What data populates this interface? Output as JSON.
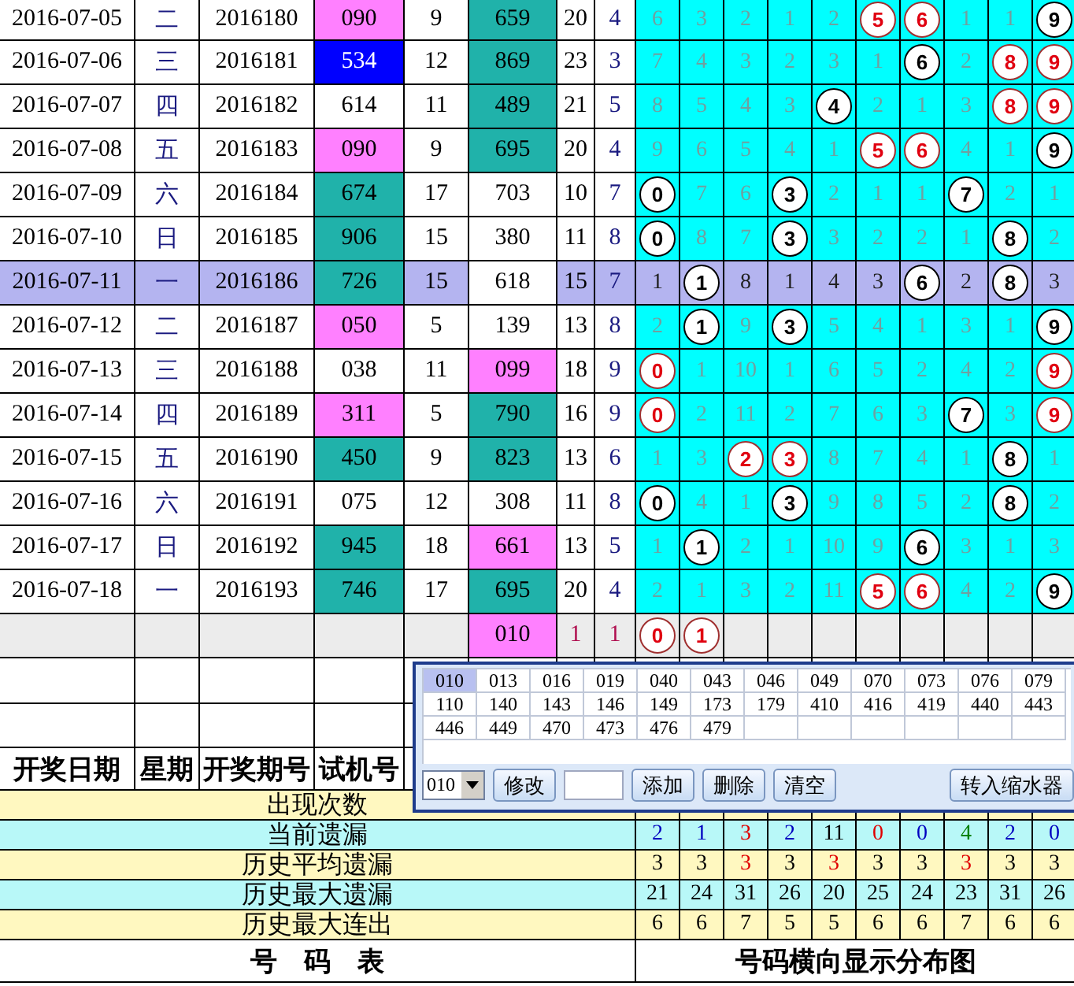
{
  "draws": [
    {
      "date": "2016-07-05",
      "weekday": "二",
      "issue": "2016180",
      "trial": {
        "text": "090",
        "color": "#ff80ff"
      },
      "column_5": "9",
      "column_6": {
        "text": "659",
        "color": "#20b2aa"
      },
      "column_7": "20",
      "column_8": "4",
      "selected": false,
      "grid": [
        {
          "text": "6",
          "kind": "miss"
        },
        {
          "text": "3",
          "kind": "miss"
        },
        {
          "text": "2",
          "kind": "miss"
        },
        {
          "text": "1",
          "kind": "miss"
        },
        {
          "text": "2",
          "kind": "miss"
        },
        {
          "text": "5",
          "kind": "repeat"
        },
        {
          "text": "6",
          "kind": "repeat"
        },
        {
          "text": "1",
          "kind": "miss"
        },
        {
          "text": "1",
          "kind": "miss"
        },
        {
          "text": "9",
          "kind": "hit"
        }
      ]
    },
    {
      "date": "2016-07-06",
      "weekday": "三",
      "issue": "2016181",
      "trial": {
        "text": "534",
        "color": "#0000ff"
      },
      "column_5": "12",
      "column_6": {
        "text": "869",
        "color": "#20b2aa"
      },
      "column_7": "23",
      "column_8": "3",
      "selected": false,
      "grid": [
        {
          "text": "7",
          "kind": "miss"
        },
        {
          "text": "4",
          "kind": "miss"
        },
        {
          "text": "3",
          "kind": "miss"
        },
        {
          "text": "2",
          "kind": "miss"
        },
        {
          "text": "3",
          "kind": "miss"
        },
        {
          "text": "1",
          "kind": "miss"
        },
        {
          "text": "6",
          "kind": "hit"
        },
        {
          "text": "2",
          "kind": "miss"
        },
        {
          "text": "8",
          "kind": "repeat"
        },
        {
          "text": "9",
          "kind": "repeat"
        }
      ]
    },
    {
      "date": "2016-07-07",
      "weekday": "四",
      "issue": "2016182",
      "trial": {
        "text": "614",
        "color": "#ffffff"
      },
      "column_5": "11",
      "column_6": {
        "text": "489",
        "color": "#20b2aa"
      },
      "column_7": "21",
      "column_8": "5",
      "selected": false,
      "grid": [
        {
          "text": "8",
          "kind": "miss"
        },
        {
          "text": "5",
          "kind": "miss"
        },
        {
          "text": "4",
          "kind": "miss"
        },
        {
          "text": "3",
          "kind": "miss"
        },
        {
          "text": "4",
          "kind": "hit"
        },
        {
          "text": "2",
          "kind": "miss"
        },
        {
          "text": "1",
          "kind": "miss"
        },
        {
          "text": "3",
          "kind": "miss"
        },
        {
          "text": "8",
          "kind": "repeat"
        },
        {
          "text": "9",
          "kind": "repeat"
        }
      ]
    },
    {
      "date": "2016-07-08",
      "weekday": "五",
      "issue": "2016183",
      "trial": {
        "text": "090",
        "color": "#ff80ff"
      },
      "column_5": "9",
      "column_6": {
        "text": "695",
        "color": "#20b2aa"
      },
      "column_7": "20",
      "column_8": "4",
      "selected": false,
      "grid": [
        {
          "text": "9",
          "kind": "miss"
        },
        {
          "text": "6",
          "kind": "miss"
        },
        {
          "text": "5",
          "kind": "miss"
        },
        {
          "text": "4",
          "kind": "miss"
        },
        {
          "text": "1",
          "kind": "miss"
        },
        {
          "text": "5",
          "kind": "repeat"
        },
        {
          "text": "6",
          "kind": "repeat"
        },
        {
          "text": "4",
          "kind": "miss"
        },
        {
          "text": "1",
          "kind": "miss"
        },
        {
          "text": "9",
          "kind": "hit"
        }
      ]
    },
    {
      "date": "2016-07-09",
      "weekday": "六",
      "issue": "2016184",
      "trial": {
        "text": "674",
        "color": "#20b2aa"
      },
      "column_5": "17",
      "column_6": {
        "text": "703",
        "color": "#ffffff"
      },
      "column_7": "10",
      "column_8": "7",
      "selected": false,
      "grid": [
        {
          "text": "0",
          "kind": "hit"
        },
        {
          "text": "7",
          "kind": "miss"
        },
        {
          "text": "6",
          "kind": "miss"
        },
        {
          "text": "3",
          "kind": "hit"
        },
        {
          "text": "2",
          "kind": "miss"
        },
        {
          "text": "1",
          "kind": "miss"
        },
        {
          "text": "1",
          "kind": "miss"
        },
        {
          "text": "7",
          "kind": "hit"
        },
        {
          "text": "2",
          "kind": "miss"
        },
        {
          "text": "1",
          "kind": "miss"
        }
      ]
    },
    {
      "date": "2016-07-10",
      "weekday": "日",
      "issue": "2016185",
      "trial": {
        "text": "906",
        "color": "#20b2aa"
      },
      "column_5": "15",
      "column_6": {
        "text": "380",
        "color": "#ffffff"
      },
      "column_7": "11",
      "column_8": "8",
      "selected": false,
      "grid": [
        {
          "text": "0",
          "kind": "hit"
        },
        {
          "text": "8",
          "kind": "miss"
        },
        {
          "text": "7",
          "kind": "miss"
        },
        {
          "text": "3",
          "kind": "hit"
        },
        {
          "text": "3",
          "kind": "miss"
        },
        {
          "text": "2",
          "kind": "miss"
        },
        {
          "text": "2",
          "kind": "miss"
        },
        {
          "text": "1",
          "kind": "miss"
        },
        {
          "text": "8",
          "kind": "hit"
        },
        {
          "text": "2",
          "kind": "miss"
        }
      ]
    },
    {
      "date": "2016-07-11",
      "weekday": "一",
      "issue": "2016186",
      "trial": {
        "text": "726",
        "color": "#20b2aa"
      },
      "column_5": "15",
      "column_6": {
        "text": "618",
        "color": "#ffffff"
      },
      "column_7": "15",
      "column_8": "7",
      "selected": true,
      "grid": [
        {
          "text": "1",
          "kind": "miss"
        },
        {
          "text": "1",
          "kind": "hit"
        },
        {
          "text": "8",
          "kind": "miss"
        },
        {
          "text": "1",
          "kind": "miss"
        },
        {
          "text": "4",
          "kind": "miss"
        },
        {
          "text": "3",
          "kind": "miss"
        },
        {
          "text": "6",
          "kind": "hit"
        },
        {
          "text": "2",
          "kind": "miss"
        },
        {
          "text": "8",
          "kind": "hit"
        },
        {
          "text": "3",
          "kind": "miss"
        }
      ]
    },
    {
      "date": "2016-07-12",
      "weekday": "二",
      "issue": "2016187",
      "trial": {
        "text": "050",
        "color": "#ff80ff"
      },
      "column_5": "5",
      "column_6": {
        "text": "139",
        "color": "#ffffff"
      },
      "column_7": "13",
      "column_8": "8",
      "selected": false,
      "grid": [
        {
          "text": "2",
          "kind": "miss"
        },
        {
          "text": "1",
          "kind": "hit"
        },
        {
          "text": "9",
          "kind": "miss"
        },
        {
          "text": "3",
          "kind": "hit"
        },
        {
          "text": "5",
          "kind": "miss"
        },
        {
          "text": "4",
          "kind": "miss"
        },
        {
          "text": "1",
          "kind": "miss"
        },
        {
          "text": "3",
          "kind": "miss"
        },
        {
          "text": "1",
          "kind": "miss"
        },
        {
          "text": "9",
          "kind": "hit"
        }
      ]
    },
    {
      "date": "2016-07-13",
      "weekday": "三",
      "issue": "2016188",
      "trial": {
        "text": "038",
        "color": "#ffffff"
      },
      "column_5": "11",
      "column_6": {
        "text": "099",
        "color": "#ff80ff"
      },
      "column_7": "18",
      "column_8": "9",
      "selected": false,
      "grid": [
        {
          "text": "0",
          "kind": "repeat"
        },
        {
          "text": "1",
          "kind": "miss"
        },
        {
          "text": "10",
          "kind": "miss"
        },
        {
          "text": "1",
          "kind": "miss"
        },
        {
          "text": "6",
          "kind": "miss"
        },
        {
          "text": "5",
          "kind": "miss"
        },
        {
          "text": "2",
          "kind": "miss"
        },
        {
          "text": "4",
          "kind": "miss"
        },
        {
          "text": "2",
          "kind": "miss"
        },
        {
          "text": "9",
          "kind": "repeat"
        }
      ]
    },
    {
      "date": "2016-07-14",
      "weekday": "四",
      "issue": "2016189",
      "trial": {
        "text": "311",
        "color": "#ff80ff"
      },
      "column_5": "5",
      "column_6": {
        "text": "790",
        "color": "#20b2aa"
      },
      "column_7": "16",
      "column_8": "9",
      "selected": false,
      "grid": [
        {
          "text": "0",
          "kind": "repeat"
        },
        {
          "text": "2",
          "kind": "miss"
        },
        {
          "text": "11",
          "kind": "miss"
        },
        {
          "text": "2",
          "kind": "miss"
        },
        {
          "text": "7",
          "kind": "miss"
        },
        {
          "text": "6",
          "kind": "miss"
        },
        {
          "text": "3",
          "kind": "miss"
        },
        {
          "text": "7",
          "kind": "hit"
        },
        {
          "text": "3",
          "kind": "miss"
        },
        {
          "text": "9",
          "kind": "repeat"
        }
      ]
    },
    {
      "date": "2016-07-15",
      "weekday": "五",
      "issue": "2016190",
      "trial": {
        "text": "450",
        "color": "#20b2aa"
      },
      "column_5": "9",
      "column_6": {
        "text": "823",
        "color": "#20b2aa"
      },
      "column_7": "13",
      "column_8": "6",
      "selected": false,
      "grid": [
        {
          "text": "1",
          "kind": "miss"
        },
        {
          "text": "3",
          "kind": "miss"
        },
        {
          "text": "2",
          "kind": "repeat"
        },
        {
          "text": "3",
          "kind": "repeat"
        },
        {
          "text": "8",
          "kind": "miss"
        },
        {
          "text": "7",
          "kind": "miss"
        },
        {
          "text": "4",
          "kind": "miss"
        },
        {
          "text": "1",
          "kind": "miss"
        },
        {
          "text": "8",
          "kind": "hit"
        },
        {
          "text": "1",
          "kind": "miss"
        }
      ]
    },
    {
      "date": "2016-07-16",
      "weekday": "六",
      "issue": "2016191",
      "trial": {
        "text": "075",
        "color": "#ffffff"
      },
      "column_5": "12",
      "column_6": {
        "text": "308",
        "color": "#ffffff"
      },
      "column_7": "11",
      "column_8": "8",
      "selected": false,
      "grid": [
        {
          "text": "0",
          "kind": "hit"
        },
        {
          "text": "4",
          "kind": "miss"
        },
        {
          "text": "1",
          "kind": "miss"
        },
        {
          "text": "3",
          "kind": "hit"
        },
        {
          "text": "9",
          "kind": "miss"
        },
        {
          "text": "8",
          "kind": "miss"
        },
        {
          "text": "5",
          "kind": "miss"
        },
        {
          "text": "2",
          "kind": "miss"
        },
        {
          "text": "8",
          "kind": "hit"
        },
        {
          "text": "2",
          "kind": "miss"
        }
      ]
    },
    {
      "date": "2016-07-17",
      "weekday": "日",
      "issue": "2016192",
      "trial": {
        "text": "945",
        "color": "#20b2aa"
      },
      "column_5": "18",
      "column_6": {
        "text": "661",
        "color": "#ff80ff"
      },
      "column_7": "13",
      "column_8": "5",
      "selected": false,
      "grid": [
        {
          "text": "1",
          "kind": "miss"
        },
        {
          "text": "1",
          "kind": "hit"
        },
        {
          "text": "2",
          "kind": "miss"
        },
        {
          "text": "1",
          "kind": "miss"
        },
        {
          "text": "10",
          "kind": "miss"
        },
        {
          "text": "9",
          "kind": "miss"
        },
        {
          "text": "6",
          "kind": "hit"
        },
        {
          "text": "3",
          "kind": "miss"
        },
        {
          "text": "1",
          "kind": "miss"
        },
        {
          "text": "3",
          "kind": "miss"
        }
      ]
    },
    {
      "date": "2016-07-18",
      "weekday": "一",
      "issue": "2016193",
      "trial": {
        "text": "746",
        "color": "#20b2aa"
      },
      "column_5": "17",
      "column_6": {
        "text": "695",
        "color": "#20b2aa"
      },
      "column_7": "20",
      "column_8": "4",
      "selected": false,
      "grid": [
        {
          "text": "2",
          "kind": "miss"
        },
        {
          "text": "1",
          "kind": "miss"
        },
        {
          "text": "3",
          "kind": "miss"
        },
        {
          "text": "2",
          "kind": "miss"
        },
        {
          "text": "11",
          "kind": "miss"
        },
        {
          "text": "5",
          "kind": "repeat"
        },
        {
          "text": "6",
          "kind": "repeat"
        },
        {
          "text": "4",
          "kind": "miss"
        },
        {
          "text": "2",
          "kind": "miss"
        },
        {
          "text": "9",
          "kind": "hit"
        }
      ]
    }
  ],
  "pending_row": {
    "column_6": {
      "text": "010",
      "color": "#ff80ff"
    },
    "column_7": "1",
    "column_8": "1",
    "grid": [
      {
        "text": "0",
        "kind": "repeat"
      },
      {
        "text": "1",
        "kind": "repeat"
      }
    ]
  },
  "headers": [
    "开奖日期",
    "星期",
    "开奖期号",
    "试机号"
  ],
  "stats": [
    {
      "label": "出现次数"
    },
    {
      "label": "当前遗漏",
      "values": [
        {
          "text": "2",
          "color": "#0000c0"
        },
        {
          "text": "1",
          "color": "#0000c0"
        },
        {
          "text": "3",
          "color": "#e00000"
        },
        {
          "text": "2",
          "color": "#0000c0"
        },
        {
          "text": "11",
          "color": "#000000"
        },
        {
          "text": "0",
          "color": "#e00000"
        },
        {
          "text": "0",
          "color": "#0000c0"
        },
        {
          "text": "4",
          "color": "#008000"
        },
        {
          "text": "2",
          "color": "#0000c0"
        },
        {
          "text": "0",
          "color": "#0000c0"
        }
      ]
    },
    {
      "label": "历史平均遗漏",
      "values": [
        {
          "text": "3",
          "color": "#000000"
        },
        {
          "text": "3",
          "color": "#000000"
        },
        {
          "text": "3",
          "color": "#e00000"
        },
        {
          "text": "3",
          "color": "#000000"
        },
        {
          "text": "3",
          "color": "#e00000"
        },
        {
          "text": "3",
          "color": "#000000"
        },
        {
          "text": "3",
          "color": "#000000"
        },
        {
          "text": "3",
          "color": "#e00000"
        },
        {
          "text": "3",
          "color": "#000000"
        },
        {
          "text": "3",
          "color": "#000000"
        }
      ]
    },
    {
      "label": "历史最大遗漏",
      "values": [
        {
          "text": "21",
          "color": "#000000"
        },
        {
          "text": "24",
          "color": "#000000"
        },
        {
          "text": "31",
          "color": "#000000"
        },
        {
          "text": "26",
          "color": "#000000"
        },
        {
          "text": "20",
          "color": "#000000"
        },
        {
          "text": "25",
          "color": "#000000"
        },
        {
          "text": "24",
          "color": "#000000"
        },
        {
          "text": "23",
          "color": "#000000"
        },
        {
          "text": "31",
          "color": "#000000"
        },
        {
          "text": "26",
          "color": "#000000"
        }
      ]
    },
    {
      "label": "历史最大连出",
      "values": [
        {
          "text": "6",
          "color": "#000000"
        },
        {
          "text": "6",
          "color": "#000000"
        },
        {
          "text": "7",
          "color": "#000000"
        },
        {
          "text": "5",
          "color": "#000000"
        },
        {
          "text": "5",
          "color": "#000000"
        },
        {
          "text": "6",
          "color": "#000000"
        },
        {
          "text": "6",
          "color": "#000000"
        },
        {
          "text": "7",
          "color": "#000000"
        },
        {
          "text": "6",
          "color": "#000000"
        },
        {
          "text": "6",
          "color": "#000000"
        }
      ]
    }
  ],
  "footer": [
    "号　码　表",
    "号码横向显示分布图"
  ],
  "popup": {
    "numbers": [
      {
        "text": "010",
        "selected": true
      },
      {
        "text": "013",
        "selected": false
      },
      {
        "text": "016",
        "selected": false
      },
      {
        "text": "019",
        "selected": false
      },
      {
        "text": "040",
        "selected": false
      },
      {
        "text": "043",
        "selected": false
      },
      {
        "text": "046",
        "selected": false
      },
      {
        "text": "049",
        "selected": false
      },
      {
        "text": "070",
        "selected": false
      },
      {
        "text": "073",
        "selected": false
      },
      {
        "text": "076",
        "selected": false
      },
      {
        "text": "079",
        "selected": false
      },
      {
        "text": "110",
        "selected": false
      },
      {
        "text": "140",
        "selected": false
      },
      {
        "text": "143",
        "selected": false
      },
      {
        "text": "146",
        "selected": false
      },
      {
        "text": "149",
        "selected": false
      },
      {
        "text": "173",
        "selected": false
      },
      {
        "text": "179",
        "selected": false
      },
      {
        "text": "410",
        "selected": false
      },
      {
        "text": "416",
        "selected": false
      },
      {
        "text": "419",
        "selected": false
      },
      {
        "text": "440",
        "selected": false
      },
      {
        "text": "443",
        "selected": false
      },
      {
        "text": "446",
        "selected": false
      },
      {
        "text": "449",
        "selected": false
      },
      {
        "text": "470",
        "selected": false
      },
      {
        "text": "473",
        "selected": false
      },
      {
        "text": "476",
        "selected": false
      },
      {
        "text": "479",
        "selected": false
      }
    ],
    "toolbar": [
      {
        "kind": "combo",
        "value": "010"
      },
      {
        "kind": "button",
        "label": "修改"
      },
      {
        "kind": "input"
      },
      {
        "kind": "button",
        "label": "添加"
      },
      {
        "kind": "button",
        "label": "删除"
      },
      {
        "kind": "button",
        "label": "清空"
      },
      {
        "kind": "spacer"
      },
      {
        "kind": "button",
        "label": "转入缩水器"
      }
    ]
  }
}
